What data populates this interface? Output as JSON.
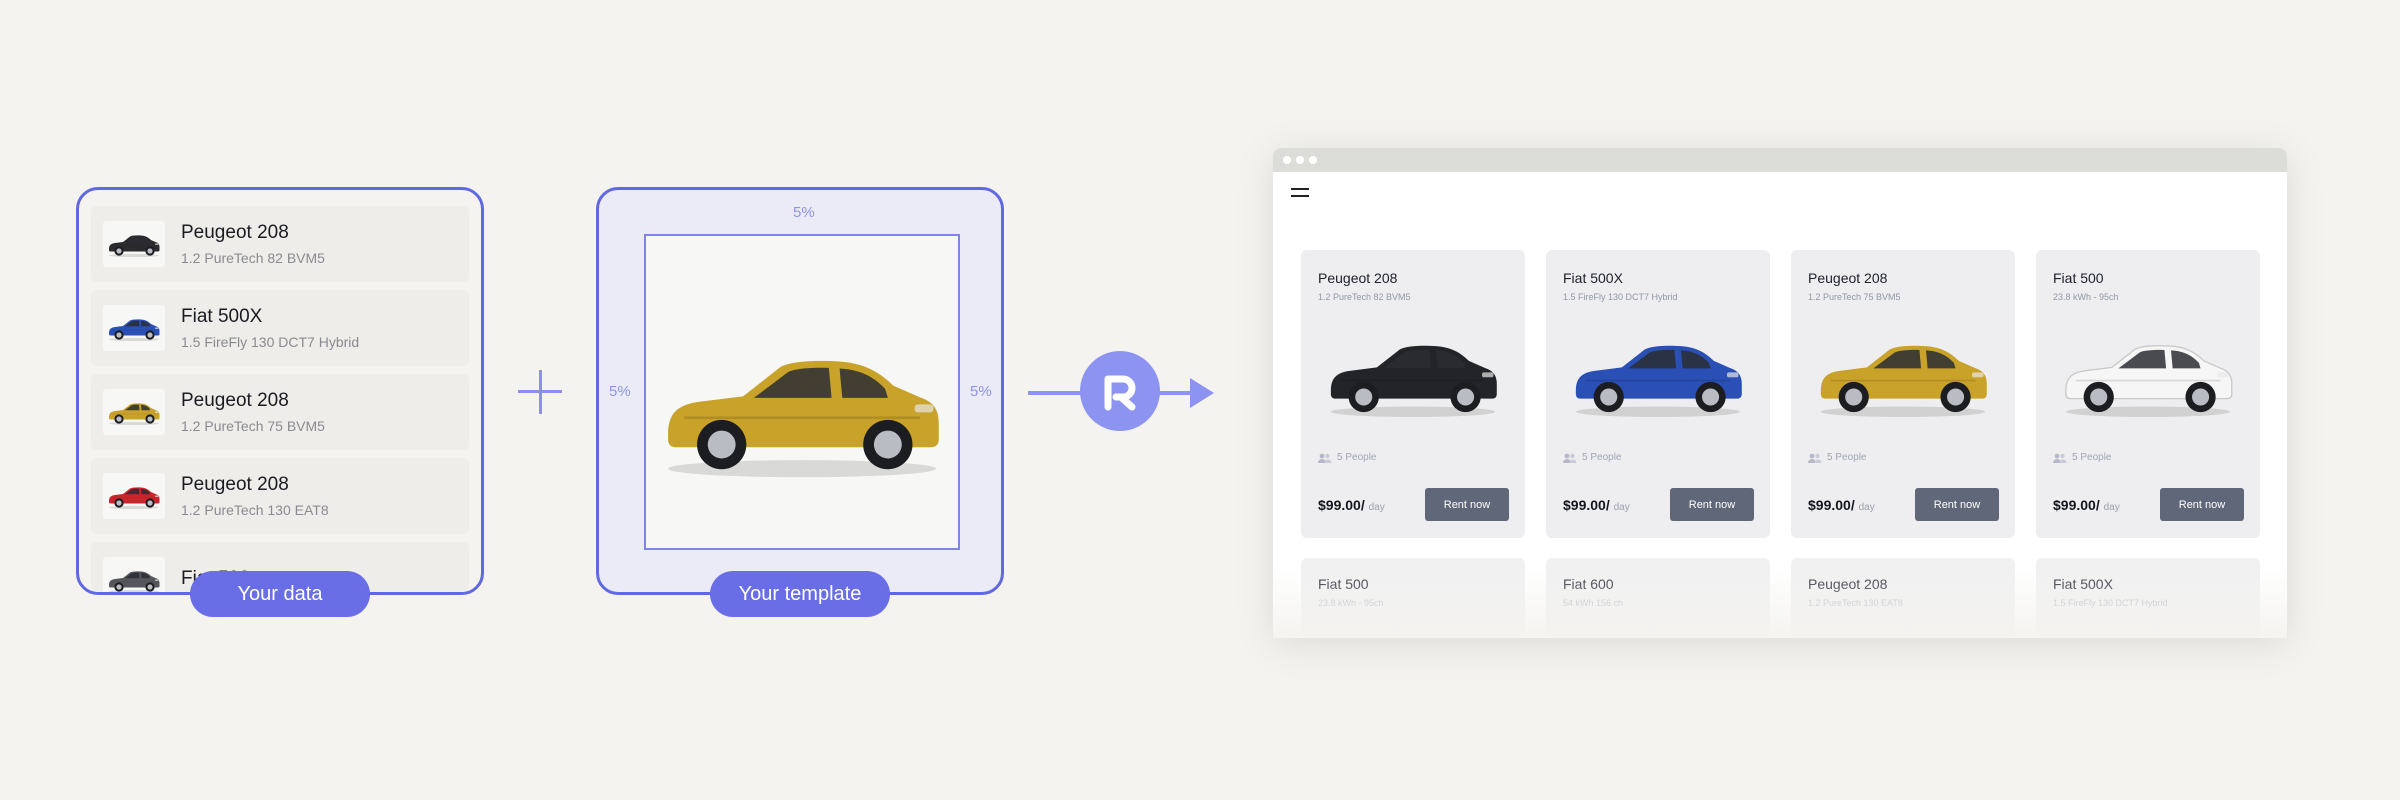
{
  "data_panel": {
    "label": "Your data",
    "items": [
      {
        "name": "Peugeot 208",
        "spec": "1.2 PureTech 82 BVM5",
        "color": "#2b2b2e"
      },
      {
        "name": "Fiat 500X",
        "spec": "1.5 FireFly 130 DCT7 Hybrid",
        "color": "#2a4fb5"
      },
      {
        "name": "Peugeot 208",
        "spec": "1.2 PureTech 75 BVM5",
        "color": "#c9a22a"
      },
      {
        "name": "Peugeot 208",
        "spec": "1.2 PureTech 130 EAT8",
        "color": "#c8262c"
      },
      {
        "name": "Fiat 500",
        "spec": "",
        "color": "#55575c"
      }
    ]
  },
  "template_panel": {
    "label": "Your template",
    "margin_top": "5%",
    "margin_left": "5%",
    "margin_right": "5%",
    "car_color": "#c9a22a"
  },
  "browser": {
    "cards": [
      {
        "name": "Peugeot 208",
        "spec": "1.2 PureTech 82 BVM5",
        "people": "5 People",
        "price": "$99.00/",
        "unit": "day",
        "button": "Rent now",
        "color": "#232427"
      },
      {
        "name": "Fiat 500X",
        "spec": "1.5 FireFly 130 DCT7 Hybrid",
        "people": "5 People",
        "price": "$99.00/",
        "unit": "day",
        "button": "Rent now",
        "color": "#2a4fb5"
      },
      {
        "name": "Peugeot 208",
        "spec": "1.2 PureTech 75 BVM5",
        "people": "5 People",
        "price": "$99.00/",
        "unit": "day",
        "button": "Rent now",
        "color": "#c9a22a"
      },
      {
        "name": "Fiat 500",
        "spec": "23.8 kWh - 95ch",
        "people": "5 People",
        "price": "$99.00/",
        "unit": "day",
        "button": "Rent now",
        "color": "#f6f6f6"
      }
    ],
    "second_row": [
      {
        "name": "Fiat 500",
        "spec": "23.8 kWh - 95ch"
      },
      {
        "name": "Fiat 600",
        "spec": "54 kWh 156 ch"
      },
      {
        "name": "Peugeot 208",
        "spec": "1.2 PureTech 130 EAT8"
      },
      {
        "name": "Fiat 500X",
        "spec": "1.5 FireFly 130 DCT7 Hybrid"
      }
    ]
  },
  "colors": {
    "accent": "#6169e0",
    "pill": "#6a6ee6",
    "arrow": "#8d93f0",
    "rent_button": "#5f6778"
  },
  "icons": {
    "logo": "r-logo-icon",
    "plus": "plus-icon",
    "menu": "hamburger-menu-icon",
    "people": "people-icon"
  }
}
